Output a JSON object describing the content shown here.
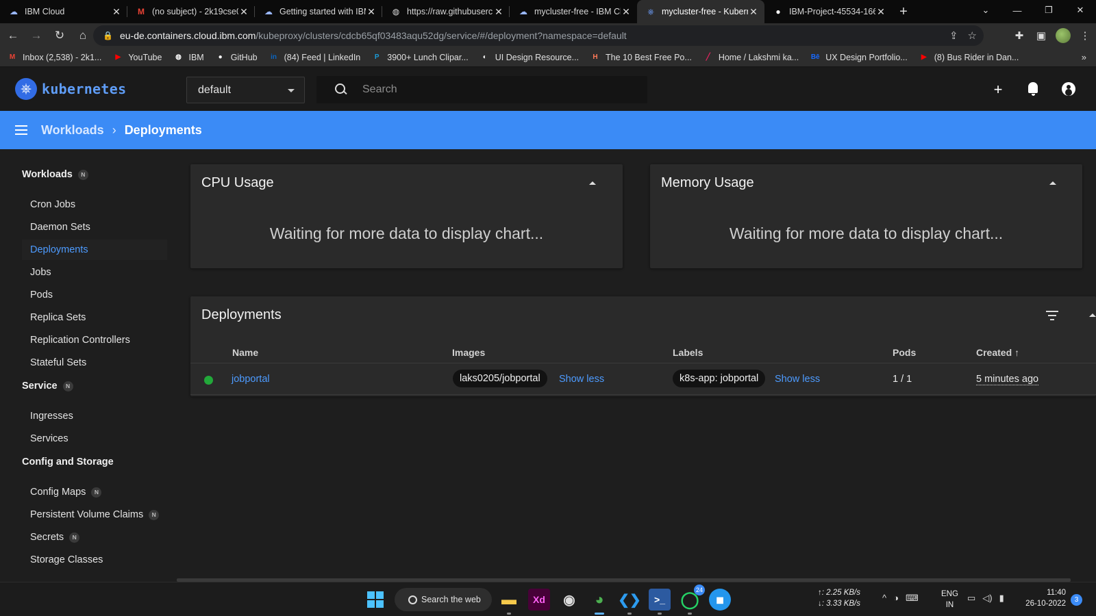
{
  "browser": {
    "tabs": [
      {
        "title": "IBM Cloud",
        "icon": "ibm-cloud-icon"
      },
      {
        "title": "(no subject) - 2k19cse0",
        "icon": "gmail-icon"
      },
      {
        "title": "Getting started with IBM",
        "icon": "ibm-cloud-icon"
      },
      {
        "title": "https://raw.githubuserc",
        "icon": "globe-icon"
      },
      {
        "title": "mycluster-free - IBM Cl",
        "icon": "ibm-cloud-icon"
      },
      {
        "title": "mycluster-free - Kuberr",
        "icon": "kubernetes-icon",
        "active": true
      },
      {
        "title": "IBM-Project-45534-166",
        "icon": "github-icon"
      }
    ],
    "url_host": "eu-de.containers.cloud.ibm.com",
    "url_path": "/kubeproxy/clusters/cdcb65qf03483aqu52dg/service/#/deployment?namespace=default",
    "bookmarks": [
      {
        "label": "Inbox (2,538) - 2k1...",
        "icon": "gmail-icon",
        "glyph": "M",
        "color": "#ea4335"
      },
      {
        "label": "YouTube",
        "icon": "youtube-icon",
        "glyph": "▶",
        "color": "#ff0000"
      },
      {
        "label": "IBM",
        "icon": "globe-icon",
        "glyph": "◍",
        "color": "#ffffff"
      },
      {
        "label": "GitHub",
        "icon": "github-icon",
        "glyph": "●",
        "color": "#ffffff"
      },
      {
        "label": "(84) Feed | LinkedIn",
        "icon": "linkedin-icon",
        "glyph": "in",
        "color": "#0a66c2"
      },
      {
        "label": "3900+ Lunch Clipar...",
        "icon": "clipart-icon",
        "glyph": "P",
        "color": "#1a9bd7"
      },
      {
        "label": "UI Design Resource...",
        "icon": "design-resource-icon",
        "glyph": "◐",
        "color": "#ffffff"
      },
      {
        "label": "The 10 Best Free Po...",
        "icon": "hubspot-icon",
        "glyph": "H",
        "color": "#ff7a59"
      },
      {
        "label": "Home / Lakshmi ka...",
        "icon": "pen-icon",
        "glyph": "╱",
        "color": "#e0245e"
      },
      {
        "label": "UX Design Portfolio...",
        "icon": "behance-icon",
        "glyph": "Bē",
        "color": "#1769ff"
      },
      {
        "label": "(8) Bus Rider in Dan...",
        "icon": "youtube-icon",
        "glyph": "▶",
        "color": "#ff0000"
      }
    ]
  },
  "app": {
    "logo_text": "kubernetes",
    "namespace": "default",
    "search_placeholder": "Search",
    "breadcrumb": {
      "root": "Workloads",
      "current": "Deployments"
    }
  },
  "sidebar": {
    "groups": [
      {
        "label": "Workloads",
        "badge": "N"
      },
      {
        "label": "Service",
        "badge": "N"
      },
      {
        "label": "Config and Storage",
        "badge": ""
      }
    ],
    "items": [
      {
        "label": "Cron Jobs",
        "badge": ""
      },
      {
        "label": "Daemon Sets",
        "badge": ""
      },
      {
        "label": "Deployments",
        "badge": "",
        "active": true
      },
      {
        "label": "Jobs",
        "badge": ""
      },
      {
        "label": "Pods",
        "badge": ""
      },
      {
        "label": "Replica Sets",
        "badge": ""
      },
      {
        "label": "Replication Controllers",
        "badge": ""
      },
      {
        "label": "Stateful Sets",
        "badge": ""
      },
      {
        "label": "Ingresses",
        "badge": ""
      },
      {
        "label": "Services",
        "badge": ""
      },
      {
        "label": "Config Maps",
        "badge": "N"
      },
      {
        "label": "Persistent Volume Claims",
        "badge": "N"
      },
      {
        "label": "Secrets",
        "badge": "N"
      },
      {
        "label": "Storage Classes",
        "badge": ""
      }
    ]
  },
  "cpu_card": {
    "title": "CPU Usage",
    "message": "Waiting for more data to display chart..."
  },
  "memory_card": {
    "title": "Memory Usage",
    "message": "Waiting for more data to display chart..."
  },
  "deployments": {
    "title": "Deployments",
    "columns": {
      "name": "Name",
      "images": "Images",
      "labels": "Labels",
      "pods": "Pods",
      "created": "Created"
    },
    "sort": {
      "column": "created",
      "direction": "ascending",
      "icon": "arrow-up-icon"
    },
    "rows": [
      {
        "status": "running",
        "status_color": "#22a83a",
        "name": "jobportal",
        "image": "laks0205/jobportal",
        "images_toggle": "Show less",
        "label": "k8s-app: jobportal",
        "labels_toggle": "Show less",
        "pods": "1 / 1",
        "created": "5 minutes ago"
      }
    ]
  },
  "taskbar": {
    "search_label": "Search the web",
    "net_up": "↑: 2.25 KB/s",
    "net_down": "↓: 3.33 KB/s",
    "lang_1": "ENG",
    "lang_2": "IN",
    "time": "11:40",
    "date": "26-10-2022",
    "notification_count": "3",
    "whatsapp_badge": "24"
  },
  "colors": {
    "accent": "#3b8bf6",
    "link": "#4d9bff",
    "status_ok": "#22a83a"
  }
}
